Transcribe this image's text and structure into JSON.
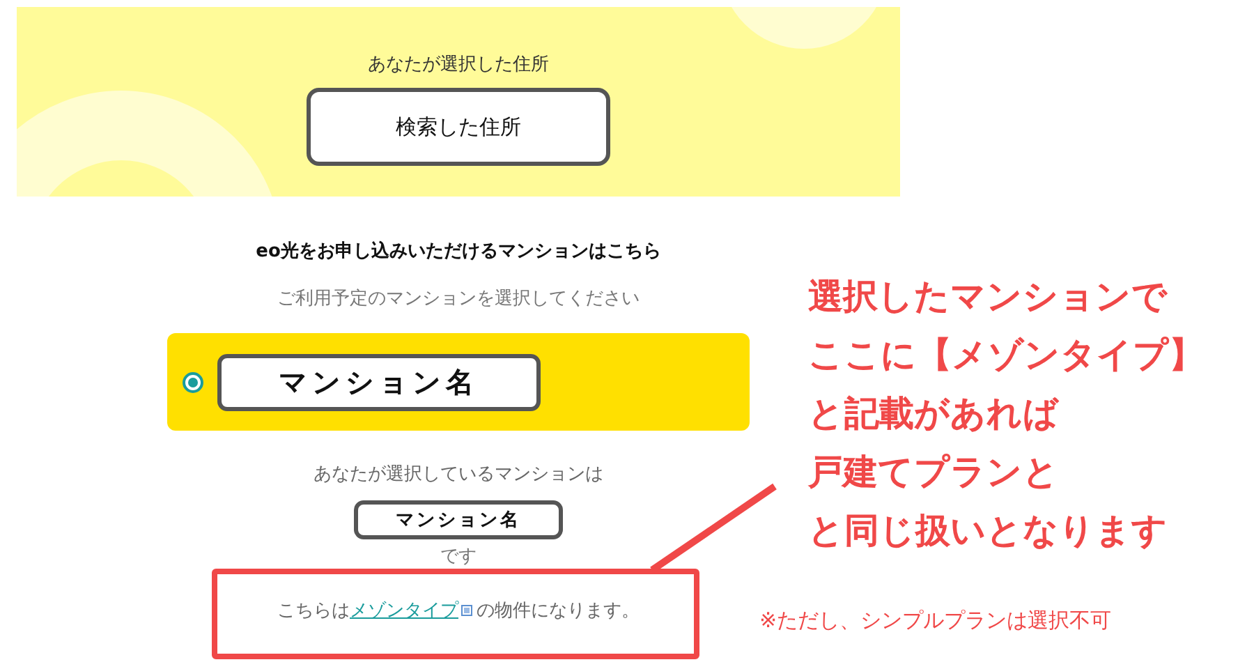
{
  "address": {
    "label": "あなたが選択した住所",
    "value": "検索した住所"
  },
  "mansion": {
    "heading": "eo光をお申し込みいただけるマンションはこちら",
    "instruction": "ご利用予定のマンションを選択してください",
    "options": [
      {
        "name": "マンション名",
        "selected": true
      }
    ],
    "selected_label": "あなたが選択しているマンションは",
    "selected_value": "マンション名",
    "suffix": "です",
    "notice": {
      "before": "こちらは",
      "link": "メゾンタイプ",
      "after": "の物件になります。"
    }
  },
  "annotation": {
    "lines": [
      "選択したマンションで",
      "ここに【メゾンタイプ】",
      "と記載があれば",
      "戸建てプランと",
      "と同じ扱いとなります"
    ],
    "note": "※ただし、シンプルプランは選択不可"
  }
}
